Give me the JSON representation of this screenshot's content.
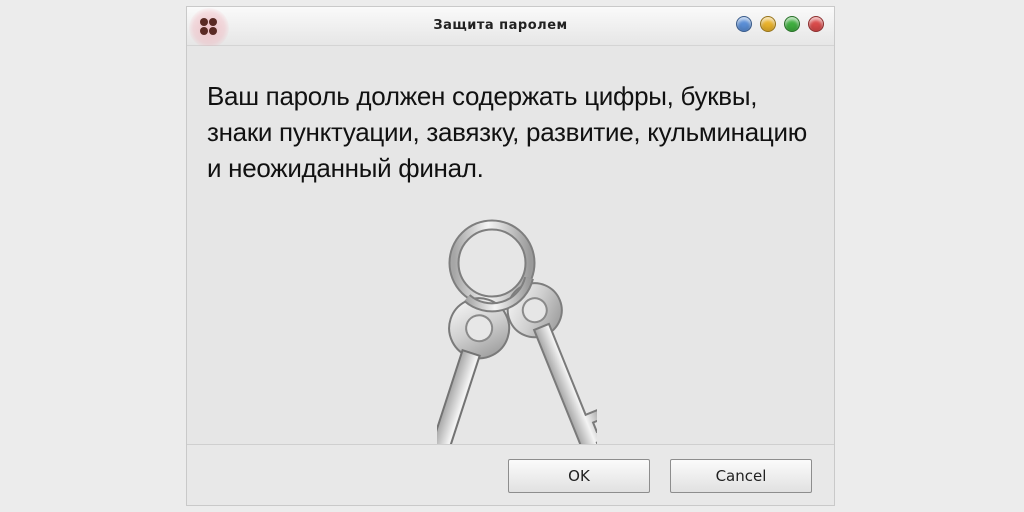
{
  "window": {
    "title": "Защита паролем",
    "controls": [
      {
        "name": "blue-window-button",
        "color": "#5a8ed6"
      },
      {
        "name": "yellow-window-button",
        "color": "#e9b22a"
      },
      {
        "name": "green-window-button",
        "color": "#3fae3f"
      },
      {
        "name": "red-window-button",
        "color": "#d94a4a"
      }
    ]
  },
  "dialog": {
    "message": "Ваш пароль должен содержать цифры, буквы, знаки пунктуации, завязку, развитие, кульминацию и неожиданный финал.",
    "icon": "keys-icon"
  },
  "buttons": {
    "ok_label": "OK",
    "cancel_label": "Cancel"
  }
}
